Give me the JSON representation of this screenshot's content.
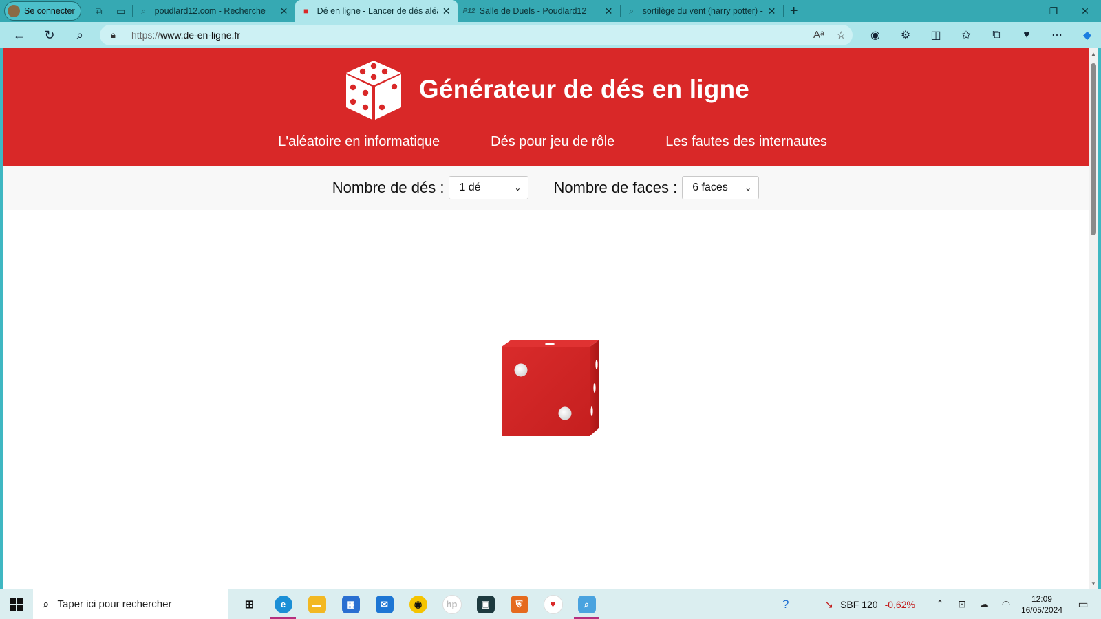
{
  "browser": {
    "profile_label": "Se connecter",
    "tabs": [
      {
        "title": "poudlard12.com - Recherche",
        "favicon": "search-icon",
        "active": false
      },
      {
        "title": "Dé en ligne - Lancer de dés aléat",
        "favicon": "dice-icon",
        "active": true
      },
      {
        "title": "Salle de Duels - Poudlard12",
        "favicon": "P12",
        "active": false
      },
      {
        "title": "sortilège du vent (harry potter) -",
        "favicon": "search-icon",
        "active": false
      }
    ],
    "url_scheme": "https://",
    "url_host": "www.de-en-ligne.fr"
  },
  "site": {
    "title": "Générateur de dés en ligne",
    "menu": [
      "L'aléatoire en informatique",
      "Dés pour jeu de rôle",
      "Les fautes des internautes"
    ],
    "controls": {
      "dice_count_label": "Nombre de dés :",
      "dice_count_value": "1 dé",
      "faces_label": "Nombre de faces :",
      "faces_value": "6 faces"
    },
    "die_result": 2,
    "accent_color": "#d92828"
  },
  "taskbar": {
    "search_placeholder": "Taper ici pour rechercher",
    "stock_name": "SBF 120",
    "stock_change": "-0,62%",
    "time": "12:09",
    "date": "16/05/2024"
  }
}
